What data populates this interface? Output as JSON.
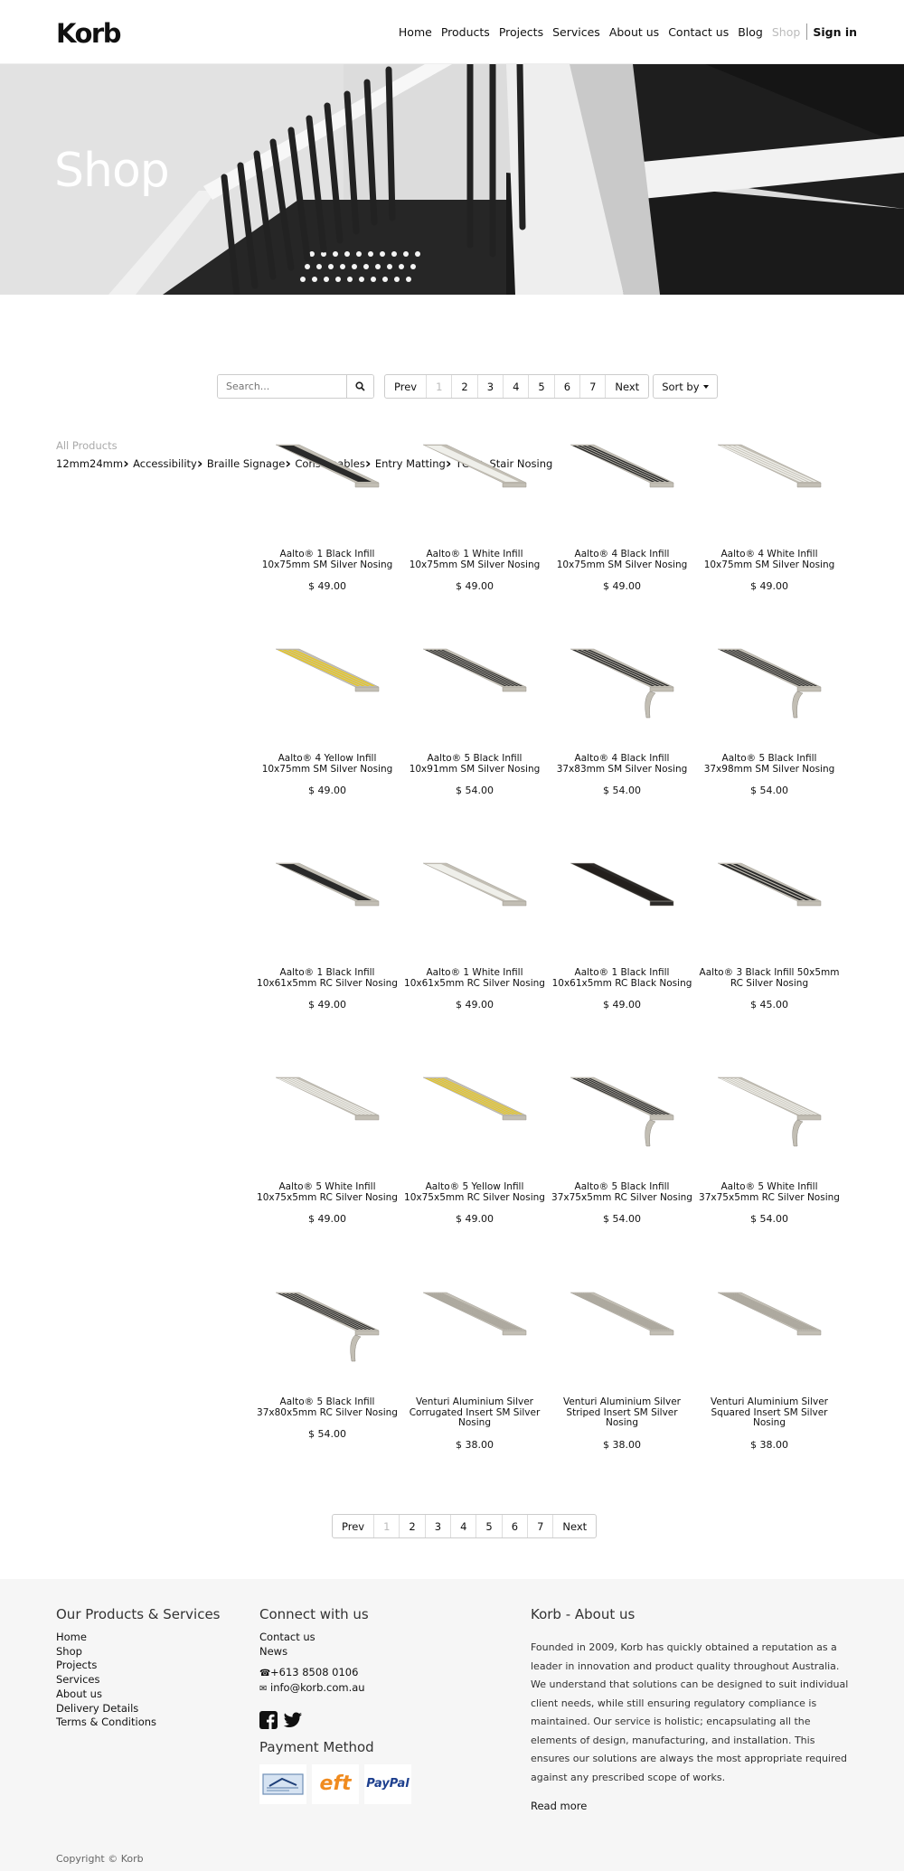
{
  "nav": {
    "logo": "Korb",
    "links": [
      "Home",
      "Products",
      "Projects",
      "Services",
      "About us",
      "Contact us",
      "Blog",
      "Shop"
    ],
    "active": "Shop",
    "signin": "Sign in"
  },
  "hero": {
    "title": "Shop"
  },
  "search": {
    "placeholder": "Search..."
  },
  "pager": {
    "prev": "Prev",
    "pages": [
      "1",
      "2",
      "3",
      "4",
      "5",
      "6",
      "7"
    ],
    "current": "1",
    "next": "Next"
  },
  "sort": {
    "label": "Sort by"
  },
  "sidebar": {
    "all": "All Products",
    "items": [
      {
        "label": "12mm",
        "expandable": false
      },
      {
        "label": "24mm",
        "expandable": false
      },
      {
        "label": "Accessibility",
        "expandable": true
      },
      {
        "label": "Braille Signage",
        "expandable": true
      },
      {
        "label": "Consumables",
        "expandable": true
      },
      {
        "label": "Entry Matting",
        "expandable": true
      },
      {
        "label": "TGSI",
        "expandable": true
      },
      {
        "label": "Stair Nosing",
        "expandable": true
      }
    ]
  },
  "products": [
    {
      "name": "Aalto® 1 Black Infill 10x75mm SM Silver Nosing",
      "price": "$ 49.00",
      "infill": "black",
      "stripes": 1,
      "style": "sm"
    },
    {
      "name": "Aalto® 1 White Infill 10x75mm SM Silver Nosing",
      "price": "$ 49.00",
      "infill": "white",
      "stripes": 1,
      "style": "sm"
    },
    {
      "name": "Aalto® 4 Black Infill 10x75mm SM Silver Nosing",
      "price": "$ 49.00",
      "infill": "black",
      "stripes": 4,
      "style": "sm"
    },
    {
      "name": "Aalto® 4 White Infill 10x75mm SM Silver Nosing",
      "price": "$ 49.00",
      "infill": "white",
      "stripes": 4,
      "style": "sm"
    },
    {
      "name": "Aalto® 4 Yellow Infill 10x75mm SM Silver Nosing",
      "price": "$ 49.00",
      "infill": "yellow",
      "stripes": 4,
      "style": "sm"
    },
    {
      "name": "Aalto® 5 Black Infill 10x91mm SM Silver Nosing",
      "price": "$ 54.00",
      "infill": "black",
      "stripes": 5,
      "style": "sm"
    },
    {
      "name": "Aalto® 4 Black Infill 37x83mm SM Silver Nosing",
      "price": "$ 54.00",
      "infill": "black",
      "stripes": 4,
      "style": "lip"
    },
    {
      "name": "Aalto® 5 Black Infill 37x98mm SM Silver Nosing",
      "price": "$ 54.00",
      "infill": "black",
      "stripes": 5,
      "style": "lip"
    },
    {
      "name": "Aalto® 1 Black Infill 10x61x5mm RC Silver Nosing",
      "price": "$ 49.00",
      "infill": "black",
      "stripes": 1,
      "style": "rc"
    },
    {
      "name": "Aalto® 1 White Infill 10x61x5mm RC Silver Nosing",
      "price": "$ 49.00",
      "infill": "white",
      "stripes": 1,
      "style": "rc"
    },
    {
      "name": "Aalto® 1 Black Infill 10x61x5mm RC Black Nosing",
      "price": "$ 49.00",
      "infill": "dark",
      "stripes": 1,
      "style": "rc"
    },
    {
      "name": "Aalto® 3 Black Infill 50x5mm RC Silver Nosing",
      "price": "$ 45.00",
      "infill": "black",
      "stripes": 3,
      "style": "rc"
    },
    {
      "name": "Aalto® 5 White Infill 10x75x5mm RC Silver Nosing",
      "price": "$ 49.00",
      "infill": "white",
      "stripes": 5,
      "style": "rc"
    },
    {
      "name": "Aalto® 5 Yellow Infill 10x75x5mm RC Silver Nosing",
      "price": "$ 49.00",
      "infill": "yellow",
      "stripes": 5,
      "style": "rc"
    },
    {
      "name": "Aalto® 5 Black Infill 37x75x5mm RC Silver Nosing",
      "price": "$ 54.00",
      "infill": "black",
      "stripes": 5,
      "style": "lip"
    },
    {
      "name": "Aalto® 5 White Infill 37x75x5mm RC Silver Nosing",
      "price": "$ 54.00",
      "infill": "white",
      "stripes": 5,
      "style": "lip"
    },
    {
      "name": "Aalto® 5 Black Infill 37x80x5mm RC Silver Nosing",
      "price": "$ 54.00",
      "infill": "black",
      "stripes": 5,
      "style": "lip"
    },
    {
      "name": "Venturi Aluminium Silver Corrugated Insert SM Silver Nosing",
      "price": "$ 38.00",
      "infill": "silver",
      "stripes": 0,
      "style": "sm"
    },
    {
      "name": "Venturi Aluminium Silver Striped Insert SM Silver Nosing",
      "price": "$ 38.00",
      "infill": "silver",
      "stripes": 0,
      "style": "sm"
    },
    {
      "name": "Venturi Aluminium Silver Squared Insert SM Silver Nosing",
      "price": "$ 38.00",
      "infill": "silver",
      "stripes": 0,
      "style": "sm"
    }
  ],
  "footer": {
    "col1": {
      "title": "Our Products & Services",
      "links": [
        "Home",
        "Shop",
        "Projects",
        "Services",
        "About us",
        "Delivery Details",
        "Terms & Conditions"
      ]
    },
    "col2": {
      "title": "Connect with us",
      "links": [
        "Contact us",
        "News"
      ],
      "phone": "+613 8508 0106",
      "email": "info@korb.com.au",
      "payment_title": "Payment Method",
      "payments": [
        "cheque",
        "eft",
        "PayPal"
      ]
    },
    "col3": {
      "title": "Korb - About us",
      "text": "Founded in 2009, Korb has quickly obtained a reputation as a leader in innovation and product quality throughout Australia. We understand that solutions can be designed to suit individual client needs, while still ensuring regulatory compliance is maintained. Our service is holistic; encapsulating all the elements of design, manufacturing, and installation. This ensures our solutions are always the most appropriate required against any prescribed scope of works.",
      "read_more": "Read more"
    },
    "copyright": "Copyright © Korb"
  },
  "colors": {
    "black": "#2a2a2a",
    "white": "#efefea",
    "yellow": "#e8c820",
    "dark": "#231f1c",
    "silver": "#c9c6bd",
    "alu": "#c2beb4"
  }
}
